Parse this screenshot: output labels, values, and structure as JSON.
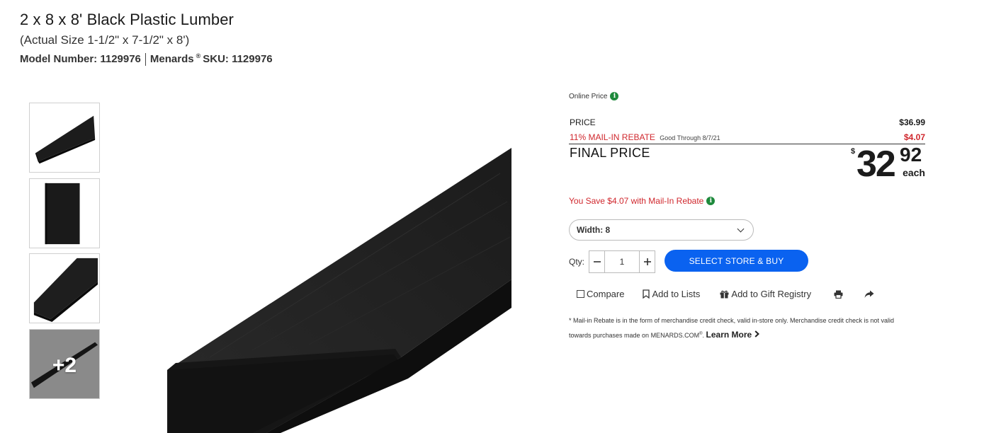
{
  "product": {
    "title": "2 x 8 x 8' Black Plastic Lumber",
    "actual_size": "(Actual Size 1-1/2\" x 7-1/2\" x 8')",
    "model_label": "Model Number: 1129976",
    "brand": "Menards",
    "registered_mark": "®",
    "sku_label": "SKU: 1129976"
  },
  "gallery": {
    "thumbnails": [
      "board-angled",
      "board-face",
      "board-diagonal"
    ],
    "more_label": "+2"
  },
  "pricing": {
    "online_price_label": "Online Price",
    "price_label": "PRICE",
    "price_value": "$36.99",
    "rebate_label": "11% MAIL-IN REBATE",
    "rebate_good_through": "Good Through 8/7/21",
    "rebate_value": "$4.07",
    "final_label": "FINAL PRICE",
    "final_currency": "$",
    "final_whole": "32",
    "final_cents": "92",
    "final_unit": "each",
    "savings_text": "You Save $4.07 with Mail-In Rebate"
  },
  "options": {
    "width_selected": "Width: 8"
  },
  "purchase": {
    "qty_label": "Qty:",
    "qty_value": "1",
    "buy_label": "SELECT STORE & BUY"
  },
  "actions": {
    "compare": "Compare",
    "add_to_lists": "Add to Lists",
    "gift_registry": "Add to Gift Registry"
  },
  "footnote": {
    "text_part1": "* Mail-in Rebate is in the form of merchandise credit check, valid in-store only. Merchandise credit check is not valid towards purchases made on MENARDS.COM",
    "registered_mark": "®",
    "text_part2": ".",
    "learn_more": "Learn More"
  },
  "colors": {
    "rebate_red": "#d0272d",
    "buy_blue": "#0a62f0",
    "info_green": "#1e8a3c"
  }
}
